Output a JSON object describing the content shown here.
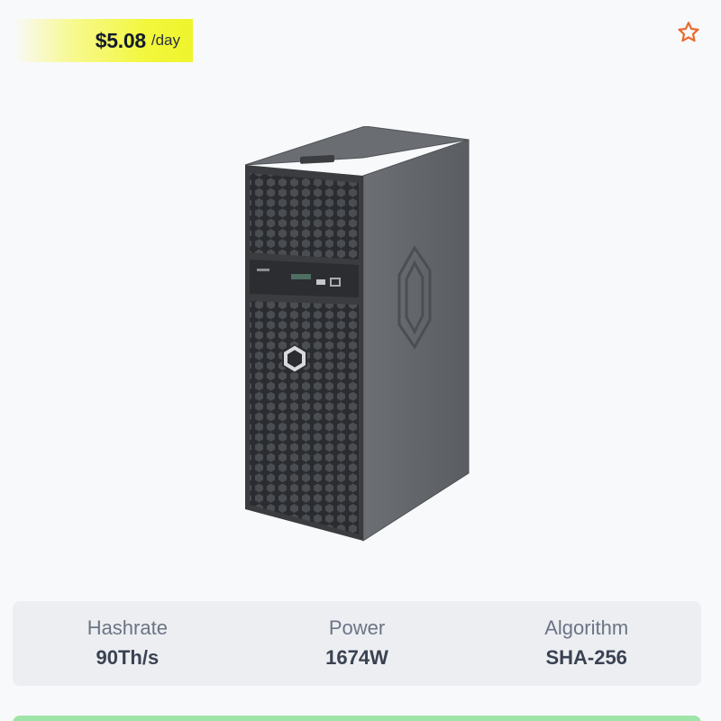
{
  "profit": {
    "amount": "$5.08",
    "unit": "/day"
  },
  "favorite": {
    "icon": "star-icon",
    "color": "#ea6a2e"
  },
  "product": {
    "image": "asic-miner-tower-image",
    "logo": "hexagon-logo-icon"
  },
  "specs": [
    {
      "label": "Hashrate",
      "value": "90Th/s"
    },
    {
      "label": "Power",
      "value": "1674W"
    },
    {
      "label": "Algorithm",
      "value": "SHA-256"
    }
  ],
  "colors": {
    "badge": "#f2f73c",
    "panel": "#eceef1",
    "accent_green": "#9fe4a8"
  }
}
